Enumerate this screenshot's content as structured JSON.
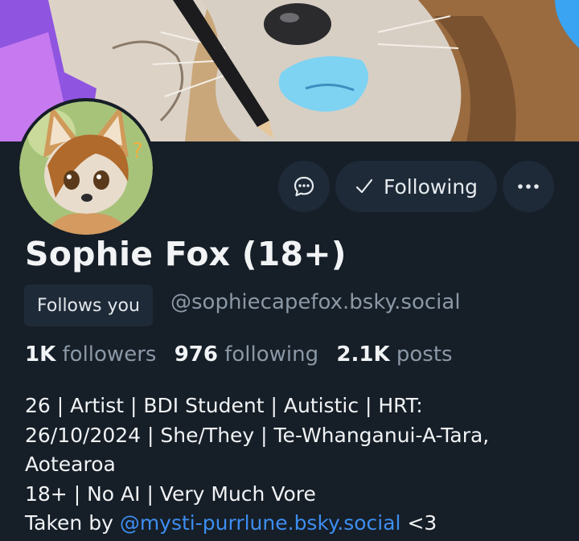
{
  "profile": {
    "display_name": "Sophie Fox (18+)",
    "handle": "@sophiecapefox.bsky.social",
    "follows_you_label": "Follows you"
  },
  "actions": {
    "following_label": "Following",
    "following_icon": "checkmark-icon",
    "message_icon": "chat-bubble-icon",
    "more_icon": "ellipsis-icon"
  },
  "stats": {
    "followers_count": "1K",
    "followers_label": "followers",
    "following_count": "976",
    "following_label": "following",
    "posts_count": "2.1K",
    "posts_label": "posts"
  },
  "bio": {
    "line1": "26 | Artist | BDI Student | Autistic | HRT:",
    "line2": "26/10/2024 | She/They | Te-Whanganui-A-Tara,",
    "line3": "Aotearoa",
    "line4": "18+ | No AI | Very Much Vore",
    "line5_prefix": "Taken by ",
    "line5_link": "@mysti-purrlune.bsky.social",
    "line5_suffix": " <3"
  },
  "colors": {
    "background": "#161e27",
    "button_bg": "#1e2a38",
    "link": "#3d8ef0",
    "muted": "#8b98a6"
  }
}
